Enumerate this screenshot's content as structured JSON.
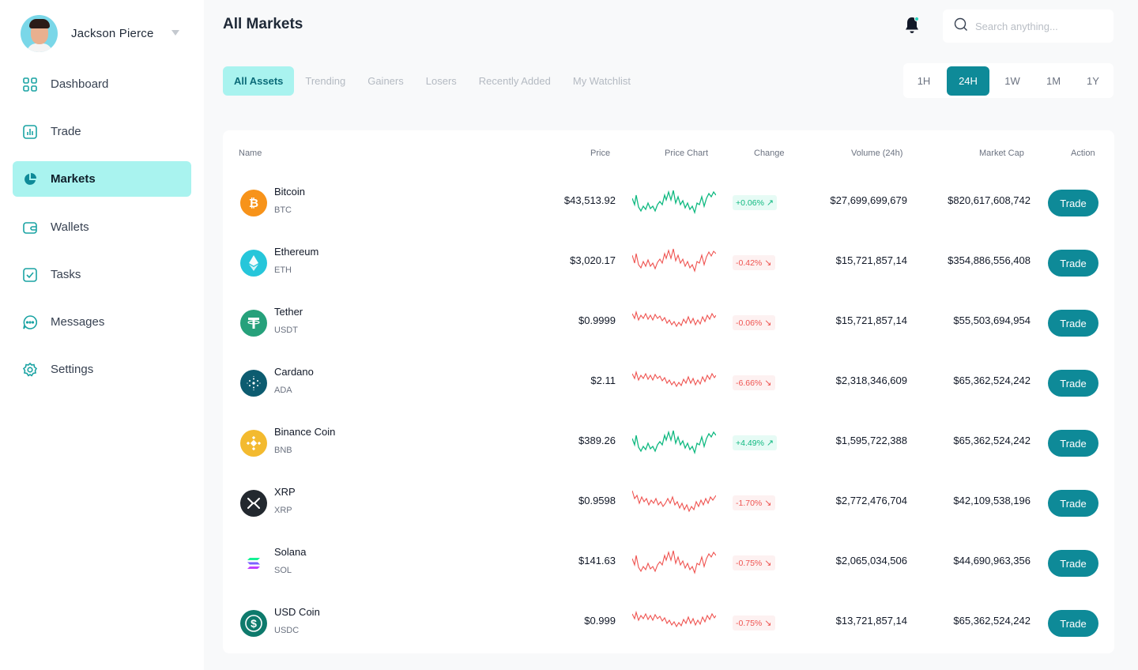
{
  "user": {
    "name": "Jackson Pierce"
  },
  "sidebar": {
    "items": [
      {
        "label": "Dashboard",
        "icon": "grid-icon"
      },
      {
        "label": "Trade",
        "icon": "bar-chart-icon"
      },
      {
        "label": "Markets",
        "icon": "pie-chart-icon",
        "active": true
      },
      {
        "label": "Wallets",
        "icon": "wallet-icon"
      },
      {
        "label": "Tasks",
        "icon": "checkbox-icon"
      },
      {
        "label": "Messages",
        "icon": "chat-icon"
      },
      {
        "label": "Settings",
        "icon": "gear-icon"
      }
    ]
  },
  "header": {
    "title": "All Markets",
    "search_placeholder": "Search anything..."
  },
  "tabs": [
    "All Assets",
    "Trending",
    "Gainers",
    "Losers",
    "Recently Added",
    "My Watchlist"
  ],
  "periods": [
    "1H",
    "24H",
    "1W",
    "1M",
    "1Y"
  ],
  "active_period": "24H",
  "table": {
    "columns": [
      "Name",
      "Price",
      "Price Chart",
      "Change",
      "Volume (24h)",
      "Market Cap",
      "Action"
    ],
    "trade_label": "Trade",
    "rows": [
      {
        "name": "Bitcoin",
        "symbol": "BTC",
        "price": "$43,513.92",
        "change": "+0.06%",
        "direction": "up",
        "volume": "$27,699,699,679",
        "market_cap": "$820,617,608,742",
        "icon_color": "#f7931a"
      },
      {
        "name": "Ethereum",
        "symbol": "ETH",
        "price": "$3,020.17",
        "change": "-0.42%",
        "direction": "down",
        "volume": "$15,721,857,14",
        "market_cap": "$354,886,556,408",
        "icon_color": "#26c6da"
      },
      {
        "name": "Tether",
        "symbol": "USDT",
        "price": "$0.9999",
        "change": "-0.06%",
        "direction": "down",
        "volume": "$15,721,857,14",
        "market_cap": "$55,503,694,954",
        "icon_color": "#26a17b"
      },
      {
        "name": "Cardano",
        "symbol": "ADA",
        "price": "$2.11",
        "change": "-6.66%",
        "direction": "down",
        "volume": "$2,318,346,609",
        "market_cap": "$65,362,524,242",
        "icon_color": "#0d5c70"
      },
      {
        "name": "Binance Coin",
        "symbol": "BNB",
        "price": "$389.26",
        "change": "+4.49%",
        "direction": "up",
        "volume": "$1,595,722,388",
        "market_cap": "$65,362,524,242",
        "icon_color": "#f3ba2f"
      },
      {
        "name": "XRP",
        "symbol": "XRP",
        "price": "$0.9598",
        "change": "-1.70%",
        "direction": "down",
        "volume": "$2,772,476,704",
        "market_cap": "$42,109,538,196",
        "icon_color": "#23292f"
      },
      {
        "name": "Solana",
        "symbol": "SOL",
        "price": "$141.63",
        "change": "-0.75%",
        "direction": "down",
        "volume": "$2,065,034,506",
        "market_cap": "$44,690,963,356",
        "icon_color": "#ffffff"
      },
      {
        "name": "USD Coin",
        "symbol": "USDC",
        "price": "$0.999",
        "change": "-0.75%",
        "direction": "down",
        "volume": "$13,721,857,14",
        "market_cap": "$65,362,524,242",
        "icon_color": "#0e7a6c"
      }
    ]
  },
  "colors": {
    "accent": "#0e8a98",
    "accent_light": "#a9f3ef",
    "up": "#10b981",
    "down": "#ef5350"
  }
}
